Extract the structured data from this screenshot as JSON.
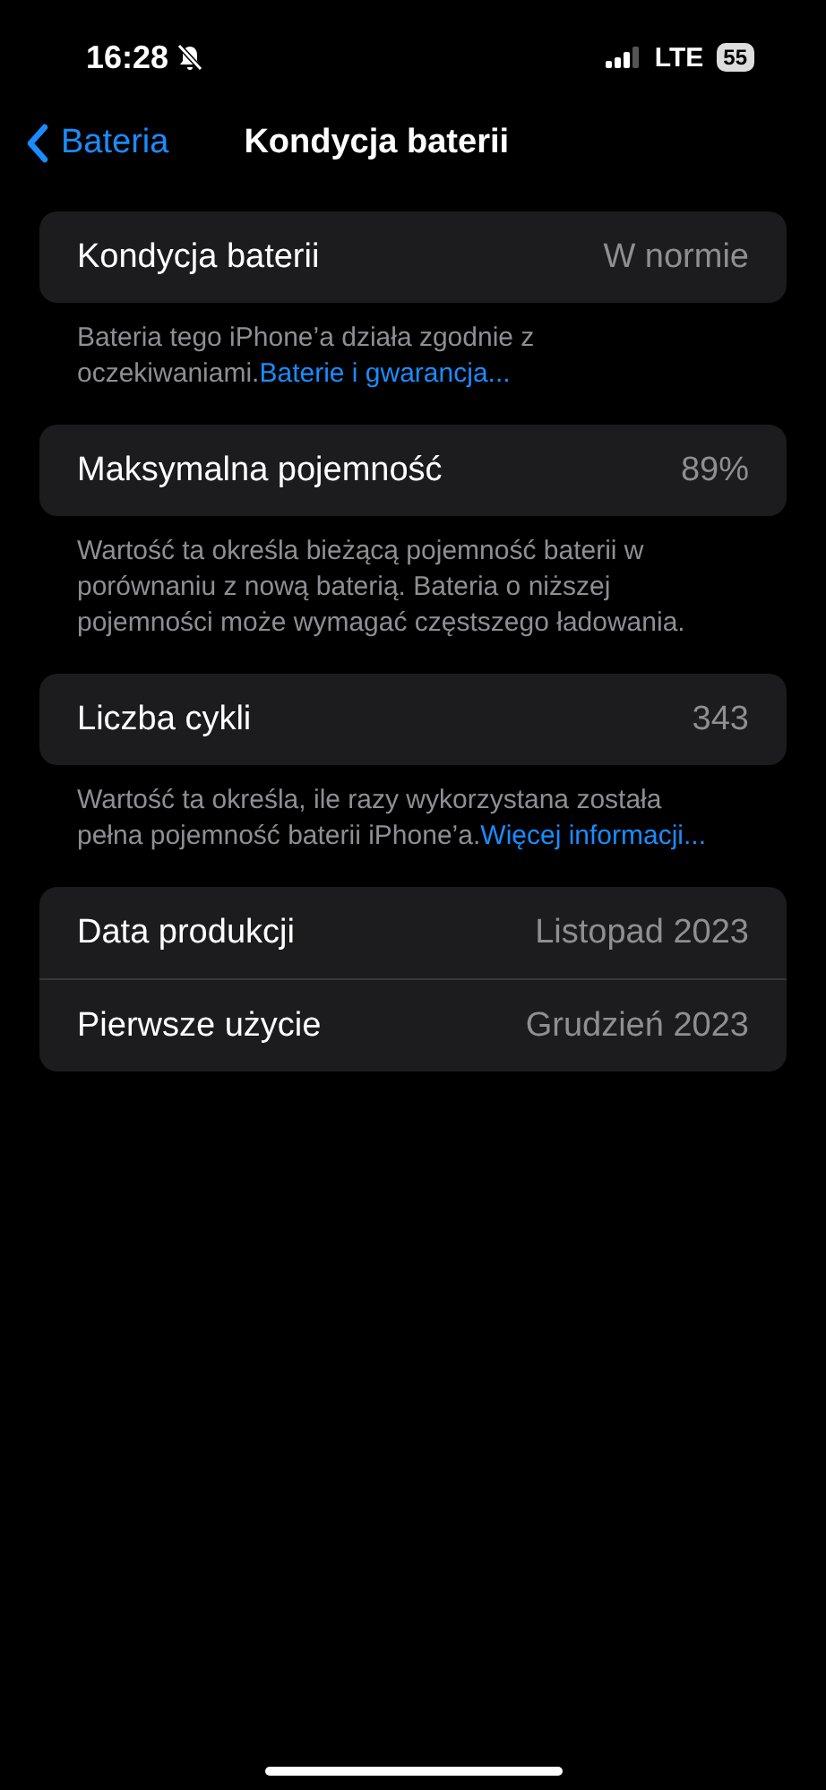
{
  "status_bar": {
    "time": "16:28",
    "silent": true,
    "network": "LTE",
    "battery": "55"
  },
  "nav": {
    "back": "Bateria",
    "title": "Kondycja baterii"
  },
  "sections": [
    {
      "rows": [
        {
          "label": "Kondycja baterii",
          "value": "W normie"
        }
      ],
      "footer": "Bateria tego iPhone’a działa zgodnie z oczekiwaniami.",
      "link": "Baterie i gwarancja..."
    },
    {
      "rows": [
        {
          "label": "Maksymalna pojemność",
          "value": "89%"
        }
      ],
      "footer": "Wartość ta określa bieżącą pojemność baterii w porównaniu z nową baterią. Bateria o niższej pojemności może wymagać częstszego ładowania."
    },
    {
      "rows": [
        {
          "label": "Liczba cykli",
          "value": "343"
        }
      ],
      "footer": "Wartość ta określa, ile razy wykorzystana została pełna pojemność baterii iPhone’a.",
      "link": "Więcej informacji..."
    },
    {
      "rows": [
        {
          "label": "Data produkcji",
          "value": "Listopad 2023"
        },
        {
          "label": "Pierwsze użycie",
          "value": "Grudzień 2023"
        }
      ]
    }
  ]
}
